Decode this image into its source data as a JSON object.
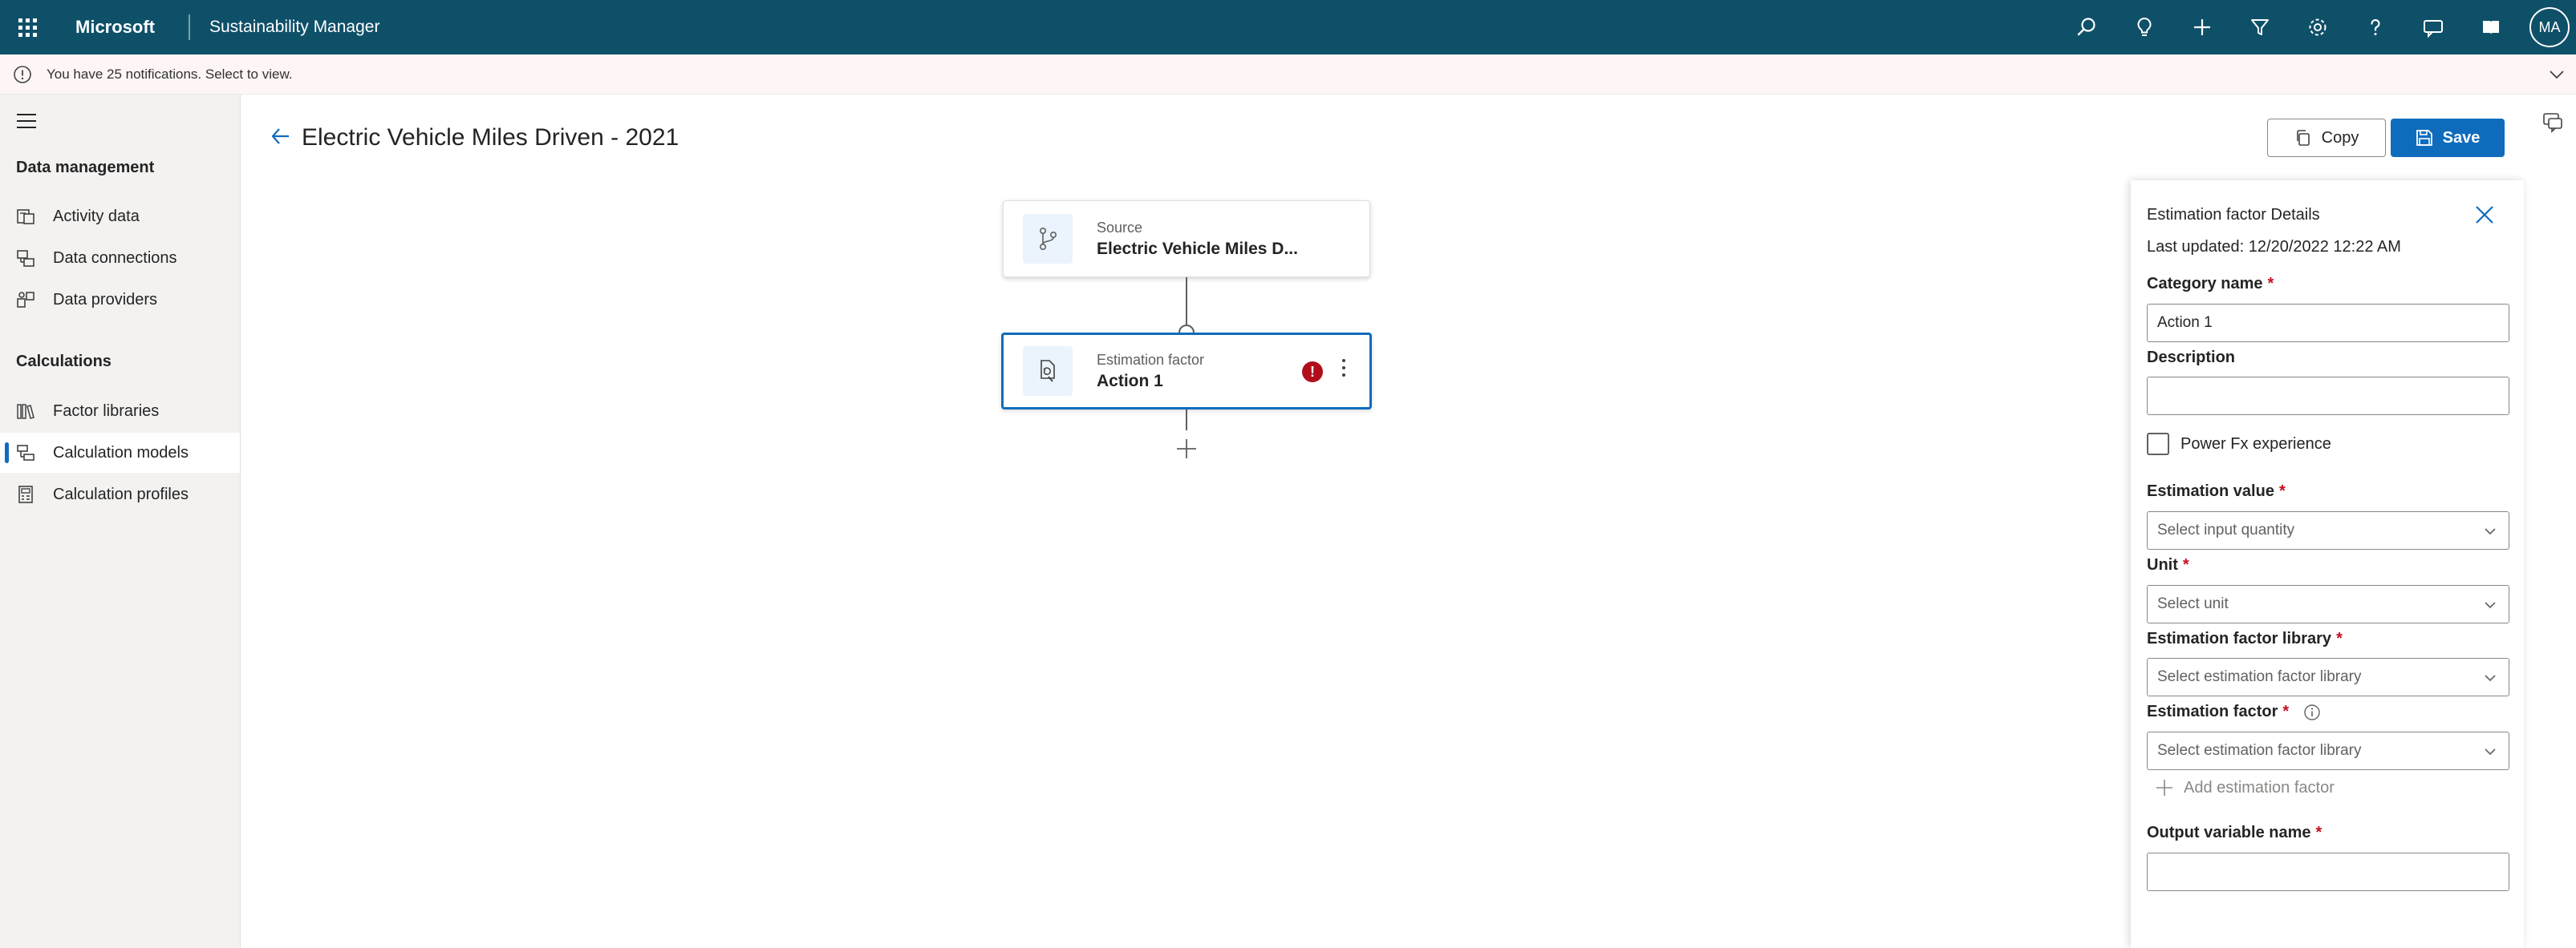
{
  "topbar": {
    "brand": "Microsoft",
    "app_name": "Sustainability Manager",
    "icons": [
      "search-icon",
      "lightbulb-icon",
      "plus-icon",
      "filter-icon",
      "gear-icon",
      "help-icon",
      "chat-icon",
      "learning-icon"
    ],
    "avatar_initials": "MA",
    "bg_color": "#0f5069"
  },
  "notifications": {
    "text": "You have 25 notifications. Select to view."
  },
  "sidebar": {
    "sections": [
      {
        "heading": "Data management",
        "items": [
          {
            "label": "Activity data",
            "icon": "activity-data-icon"
          },
          {
            "label": "Data connections",
            "icon": "data-connections-icon"
          },
          {
            "label": "Data providers",
            "icon": "data-providers-icon"
          }
        ]
      },
      {
        "heading": "Calculations",
        "items": [
          {
            "label": "Factor libraries",
            "icon": "library-icon"
          },
          {
            "label": "Calculation models",
            "icon": "calculation-model-icon",
            "active": true
          },
          {
            "label": "Calculation profiles",
            "icon": "calculation-profile-icon"
          }
        ]
      }
    ]
  },
  "header": {
    "title": "Electric Vehicle Miles Driven - 2021",
    "copy_label": "Copy",
    "save_label": "Save"
  },
  "flow": {
    "source_node": {
      "sub": "Source",
      "main": "Electric Vehicle Miles D..."
    },
    "estimation_node": {
      "sub": "Estimation factor",
      "main": "Action 1",
      "has_error": true
    }
  },
  "panel": {
    "title": "Estimation factor Details",
    "last_updated": "Last updated: 12/20/2022 12:22 AM",
    "category_name_label": "Category name",
    "category_name_value": "Action 1",
    "description_label": "Description",
    "description_value": "",
    "powerfx_label": "Power Fx experience",
    "powerfx_checked": false,
    "estimation_value_label": "Estimation value",
    "estimation_value_placeholder": "Select input quantity",
    "unit_label": "Unit",
    "unit_placeholder": "Select unit",
    "library_label": "Estimation factor library",
    "library_placeholder": "Select estimation factor library",
    "factor_label": "Estimation factor",
    "factor_placeholder": "Select estimation factor library",
    "add_factor_label": "Add estimation factor",
    "output_label": "Output variable name",
    "output_value": "",
    "required_mark": "*"
  },
  "colors": {
    "accent": "#0f6cbd",
    "error": "#b10e1c",
    "required": "#c50f1f"
  }
}
